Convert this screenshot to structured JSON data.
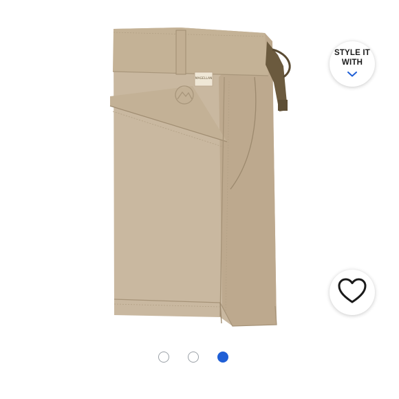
{
  "product_image": {
    "alt": "Magellan khaki shorts, side view",
    "label_text": "MAGELLAN",
    "fabric_color": "#c8b79f",
    "strap_color": "#6b5a3e"
  },
  "style_it_with": {
    "line1": "STYLE IT",
    "line2": "WITH",
    "icon": "chevron-down-icon",
    "accent_color": "#1f5fd6"
  },
  "favorite": {
    "icon": "heart-outline-icon"
  },
  "carousel": {
    "slide_count": 3,
    "active_index": 2,
    "active_color": "#1f5fd6"
  }
}
